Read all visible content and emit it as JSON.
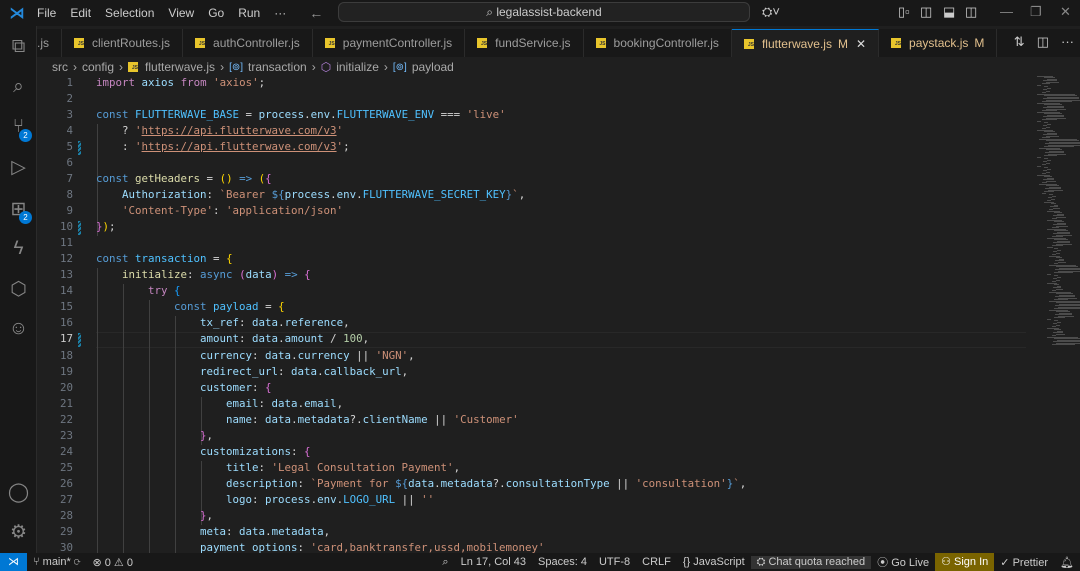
{
  "titlebar": {
    "menus": [
      "File",
      "Edit",
      "Selection",
      "View",
      "Go",
      "Run",
      "···"
    ],
    "search": "legalassist-backend"
  },
  "activity": {
    "scm_badge": "2",
    "ext_badge": "2"
  },
  "tabs": [
    {
      "label": ".js",
      "partial": true
    },
    {
      "label": "clientRoutes.js"
    },
    {
      "label": "authController.js"
    },
    {
      "label": "paymentController.js"
    },
    {
      "label": "fundService.js"
    },
    {
      "label": "bookingController.js"
    },
    {
      "label": "flutterwave.js",
      "status": "M",
      "active": true
    },
    {
      "label": "paystack.js",
      "status": "M"
    }
  ],
  "breadcrumb": [
    "src",
    "config",
    "flutterwave.js",
    "transaction",
    "initialize",
    "payload"
  ],
  "editor": {
    "current_line": 17,
    "lines": [
      [
        [
          "c",
          "import"
        ],
        [
          "p",
          " "
        ],
        [
          "v",
          "axios"
        ],
        [
          "p",
          " "
        ],
        [
          "c",
          "from"
        ],
        [
          "p",
          " "
        ],
        [
          "s",
          "'axios'"
        ],
        [
          "p",
          ";"
        ]
      ],
      [],
      [
        [
          "k",
          "const"
        ],
        [
          "p",
          " "
        ],
        [
          "C",
          "FLUTTERWAVE_BASE"
        ],
        [
          "p",
          " = "
        ],
        [
          "v",
          "process"
        ],
        [
          "p",
          "."
        ],
        [
          "v",
          "env"
        ],
        [
          "p",
          "."
        ],
        [
          "C",
          "FLUTTERWAVE_ENV"
        ],
        [
          "p",
          " === "
        ],
        [
          "s",
          "'live'"
        ]
      ],
      [
        [
          "p",
          "    ? "
        ],
        [
          "s",
          "'"
        ],
        [
          "u",
          "https://api.flutterwave.com/v3"
        ],
        [
          "s",
          "'"
        ]
      ],
      [
        [
          "p",
          "    : "
        ],
        [
          "s",
          "'"
        ],
        [
          "u",
          "https://api.flutterwave.com/v3"
        ],
        [
          "s",
          "'"
        ],
        [
          "p",
          ";"
        ]
      ],
      [],
      [
        [
          "k",
          "const"
        ],
        [
          "p",
          " "
        ],
        [
          "f",
          "getHeaders"
        ],
        [
          "p",
          " = "
        ],
        [
          "b1",
          "()"
        ],
        [
          "k",
          " =>"
        ],
        [
          "p",
          " "
        ],
        [
          "b1",
          "("
        ],
        [
          "b2",
          "{"
        ]
      ],
      [
        [
          "p",
          "    "
        ],
        [
          "v",
          "Authorization"
        ],
        [
          "p",
          ": "
        ],
        [
          "s",
          "`Bearer "
        ],
        [
          "k",
          "${"
        ],
        [
          "v",
          "process"
        ],
        [
          "p",
          "."
        ],
        [
          "v",
          "env"
        ],
        [
          "p",
          "."
        ],
        [
          "C",
          "FLUTTERWAVE_SECRET_KEY"
        ],
        [
          "k",
          "}"
        ],
        [
          "s",
          "`"
        ],
        [
          "p",
          ","
        ]
      ],
      [
        [
          "p",
          "    "
        ],
        [
          "s",
          "'Content-Type'"
        ],
        [
          "p",
          ": "
        ],
        [
          "s",
          "'application/json'"
        ]
      ],
      [
        [
          "b2",
          "}"
        ],
        [
          "b1",
          ")"
        ],
        [
          "p",
          ";"
        ]
      ],
      [],
      [
        [
          "k",
          "const"
        ],
        [
          "p",
          " "
        ],
        [
          "C",
          "transaction"
        ],
        [
          "p",
          " = "
        ],
        [
          "b1",
          "{"
        ]
      ],
      [
        [
          "p",
          "    "
        ],
        [
          "f",
          "initialize"
        ],
        [
          "p",
          ": "
        ],
        [
          "k",
          "async"
        ],
        [
          "p",
          " "
        ],
        [
          "b2",
          "("
        ],
        [
          "v",
          "data"
        ],
        [
          "b2",
          ")"
        ],
        [
          "k",
          " =>"
        ],
        [
          "p",
          " "
        ],
        [
          "b2",
          "{"
        ]
      ],
      [
        [
          "p",
          "        "
        ],
        [
          "c",
          "try"
        ],
        [
          "p",
          " "
        ],
        [
          "b3",
          "{"
        ]
      ],
      [
        [
          "p",
          "            "
        ],
        [
          "k",
          "const"
        ],
        [
          "p",
          " "
        ],
        [
          "C",
          "payload"
        ],
        [
          "p",
          " = "
        ],
        [
          "b1",
          "{"
        ]
      ],
      [
        [
          "p",
          "                "
        ],
        [
          "v",
          "tx_ref"
        ],
        [
          "p",
          ": "
        ],
        [
          "v",
          "data"
        ],
        [
          "p",
          "."
        ],
        [
          "v",
          "reference"
        ],
        [
          "p",
          ","
        ]
      ],
      [
        [
          "p",
          "                "
        ],
        [
          "v",
          "amount"
        ],
        [
          "p",
          ": "
        ],
        [
          "v",
          "data"
        ],
        [
          "p",
          "."
        ],
        [
          "v",
          "amount"
        ],
        [
          "p",
          " / "
        ],
        [
          "n",
          "100"
        ],
        [
          "p",
          ","
        ]
      ],
      [
        [
          "p",
          "                "
        ],
        [
          "v",
          "currency"
        ],
        [
          "p",
          ": "
        ],
        [
          "v",
          "data"
        ],
        [
          "p",
          "."
        ],
        [
          "v",
          "currency"
        ],
        [
          "p",
          " || "
        ],
        [
          "s",
          "'NGN'"
        ],
        [
          "p",
          ","
        ]
      ],
      [
        [
          "p",
          "                "
        ],
        [
          "v",
          "redirect_url"
        ],
        [
          "p",
          ": "
        ],
        [
          "v",
          "data"
        ],
        [
          "p",
          "."
        ],
        [
          "v",
          "callback_url"
        ],
        [
          "p",
          ","
        ]
      ],
      [
        [
          "p",
          "                "
        ],
        [
          "v",
          "customer"
        ],
        [
          "p",
          ": "
        ],
        [
          "b2",
          "{"
        ]
      ],
      [
        [
          "p",
          "                    "
        ],
        [
          "v",
          "email"
        ],
        [
          "p",
          ": "
        ],
        [
          "v",
          "data"
        ],
        [
          "p",
          "."
        ],
        [
          "v",
          "email"
        ],
        [
          "p",
          ","
        ]
      ],
      [
        [
          "p",
          "                    "
        ],
        [
          "v",
          "name"
        ],
        [
          "p",
          ": "
        ],
        [
          "v",
          "data"
        ],
        [
          "p",
          "."
        ],
        [
          "v",
          "metadata"
        ],
        [
          "p",
          "?."
        ],
        [
          "v",
          "clientName"
        ],
        [
          "p",
          " || "
        ],
        [
          "s",
          "'Customer'"
        ]
      ],
      [
        [
          "p",
          "                "
        ],
        [
          "b2",
          "}"
        ],
        [
          "p",
          ","
        ]
      ],
      [
        [
          "p",
          "                "
        ],
        [
          "v",
          "customizations"
        ],
        [
          "p",
          ": "
        ],
        [
          "b2",
          "{"
        ]
      ],
      [
        [
          "p",
          "                    "
        ],
        [
          "v",
          "title"
        ],
        [
          "p",
          ": "
        ],
        [
          "s",
          "'Legal Consultation Payment'"
        ],
        [
          "p",
          ","
        ]
      ],
      [
        [
          "p",
          "                    "
        ],
        [
          "v",
          "description"
        ],
        [
          "p",
          ": "
        ],
        [
          "s",
          "`Payment for "
        ],
        [
          "k",
          "${"
        ],
        [
          "v",
          "data"
        ],
        [
          "p",
          "."
        ],
        [
          "v",
          "metadata"
        ],
        [
          "p",
          "?."
        ],
        [
          "v",
          "consultationType"
        ],
        [
          "p",
          " || "
        ],
        [
          "s",
          "'consultation'"
        ],
        [
          "k",
          "}"
        ],
        [
          "s",
          "`"
        ],
        [
          "p",
          ","
        ]
      ],
      [
        [
          "p",
          "                    "
        ],
        [
          "v",
          "logo"
        ],
        [
          "p",
          ": "
        ],
        [
          "v",
          "process"
        ],
        [
          "p",
          "."
        ],
        [
          "v",
          "env"
        ],
        [
          "p",
          "."
        ],
        [
          "C",
          "LOGO_URL"
        ],
        [
          "p",
          " || "
        ],
        [
          "s",
          "''"
        ]
      ],
      [
        [
          "p",
          "                "
        ],
        [
          "b2",
          "}"
        ],
        [
          "p",
          ","
        ]
      ],
      [
        [
          "p",
          "                "
        ],
        [
          "v",
          "meta"
        ],
        [
          "p",
          ": "
        ],
        [
          "v",
          "data"
        ],
        [
          "p",
          "."
        ],
        [
          "v",
          "metadata"
        ],
        [
          "p",
          ","
        ]
      ],
      [
        [
          "p",
          "                "
        ],
        [
          "v",
          "payment_options"
        ],
        [
          "p",
          ": "
        ],
        [
          "s",
          "'card,banktransfer,ussd,mobilemoney'"
        ]
      ]
    ]
  },
  "status": {
    "branch": "main*",
    "errors": "0",
    "warnings": "0",
    "position": "Ln 17, Col 43",
    "spaces": "Spaces: 4",
    "encoding": "UTF-8",
    "eol": "CRLF",
    "language": "JavaScript",
    "chat": "Chat quota reached",
    "golive": "Go Live",
    "signin": "Sign In",
    "prettier": "Prettier"
  }
}
